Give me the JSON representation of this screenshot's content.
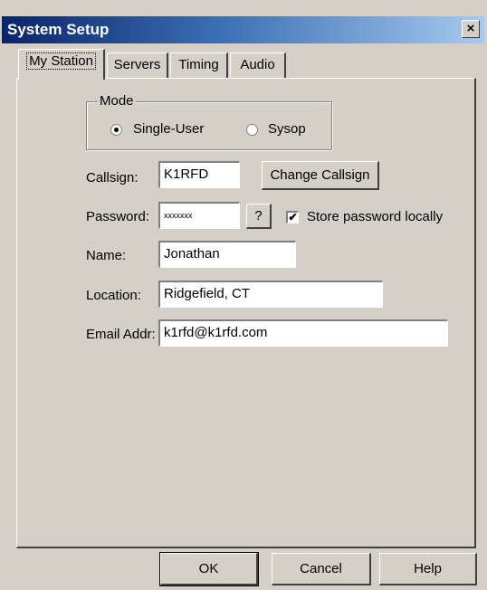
{
  "window": {
    "title": "System Setup",
    "close_glyph": "×",
    "close_icon": "close-icon"
  },
  "tabs": [
    {
      "label": "My Station",
      "active": true
    },
    {
      "label": "Servers",
      "active": false
    },
    {
      "label": "Timing",
      "active": false
    },
    {
      "label": "Audio",
      "active": false
    }
  ],
  "mode": {
    "legend": "Mode",
    "options": [
      {
        "label": "Single-User",
        "selected": true
      },
      {
        "label": "Sysop",
        "selected": false
      }
    ]
  },
  "form": {
    "callsign_label": "Callsign:",
    "callsign_value": "K1RFD",
    "change_callsign_label": "Change Callsign",
    "password_label": "Password:",
    "password_value": "xxxxxxx",
    "password_help_label": "?",
    "store_password_label": "Store password locally",
    "store_password_checked": true,
    "check_glyph": "✔",
    "name_label": "Name:",
    "name_value": "Jonathan",
    "location_label": "Location:",
    "location_value": "Ridgefield, CT",
    "email_label": "Email Addr:",
    "email_value": "k1rfd@k1rfd.com"
  },
  "footer": {
    "ok_label": "OK",
    "cancel_label": "Cancel",
    "help_label": "Help"
  },
  "colors": {
    "face": "#d4d0c8",
    "title_start": "#0a246a",
    "title_end": "#a6caf0"
  }
}
